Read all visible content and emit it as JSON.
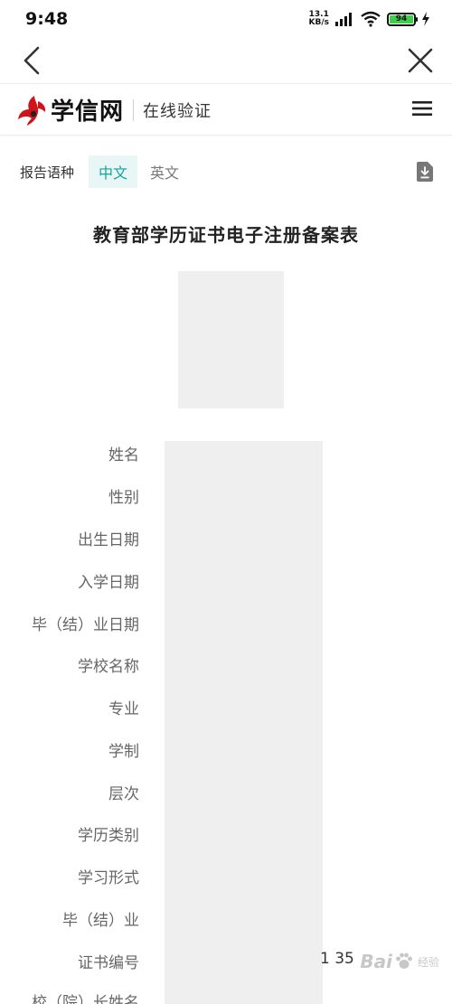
{
  "status_bar": {
    "time": "9:48",
    "net_speed_value": "13.1",
    "net_speed_unit": "KB/s",
    "battery_level": "94"
  },
  "header": {
    "logo_text": "学信网",
    "subtitle": "在线验证"
  },
  "language": {
    "label": "报告语种",
    "options": [
      "中文",
      "英文"
    ],
    "selected": "中文"
  },
  "document": {
    "title": "教育部学历证书电子注册备案表",
    "fields": [
      {
        "label": "姓名"
      },
      {
        "label": "性别"
      },
      {
        "label": "出生日期"
      },
      {
        "label": "入学日期"
      },
      {
        "label": "毕（结）业日期"
      },
      {
        "label": "学校名称"
      },
      {
        "label": "专业"
      },
      {
        "label": "学制"
      },
      {
        "label": "层次"
      },
      {
        "label": "学历类别"
      },
      {
        "label": "学习形式"
      },
      {
        "label": "毕（结）业"
      },
      {
        "label": "证书编号",
        "visible_value_tail": "1 35"
      },
      {
        "label": "校（院）长姓名"
      }
    ]
  },
  "watermark": {
    "brand_a": "Bai",
    "brand_b": "经验"
  },
  "colors": {
    "accent": "#15a29a",
    "accent_bg": "#e8f7f6",
    "logo_red": "#d0121b",
    "mask_gray": "#efefef"
  },
  "icons": [
    "back-arrow-icon",
    "close-icon",
    "menu-icon",
    "download-icon",
    "signal-icon",
    "wifi-icon",
    "battery-icon",
    "charging-icon"
  ]
}
